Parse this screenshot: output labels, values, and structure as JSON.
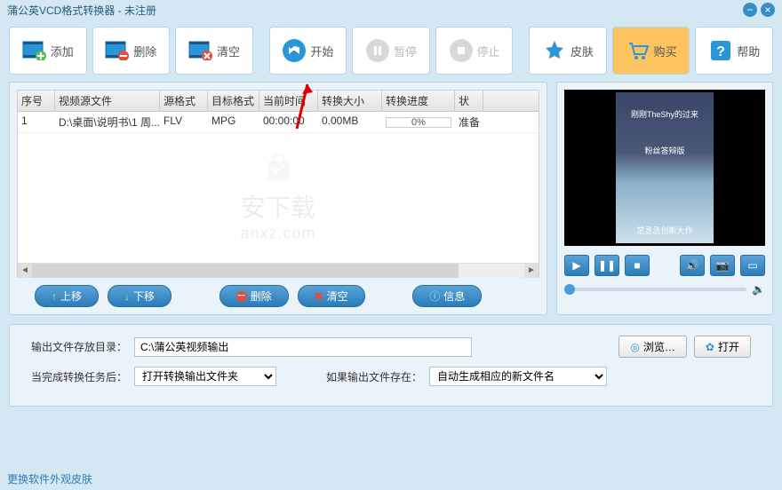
{
  "title": "蒲公英VCD格式转换器 - 未注册",
  "toolbar": {
    "add": "添加",
    "delete": "删除",
    "clear": "清空",
    "start": "开始",
    "pause": "暂停",
    "stop": "停止",
    "skin": "皮肤",
    "buy": "购买",
    "help": "帮助"
  },
  "table": {
    "headers": {
      "seq": "序号",
      "src": "视频源文件",
      "sf": "源格式",
      "tf": "目标格式",
      "ct": "当前时间",
      "sz": "转换大小",
      "pg": "转换进度",
      "st": "状"
    },
    "rows": [
      {
        "seq": "1",
        "src": "D:\\桌面\\说明书\\1 周...",
        "sf": "FLV",
        "tf": "MPG",
        "ct": "00:00:00",
        "sz": "0.00MB",
        "pg": "0%",
        "st": "准备"
      }
    ]
  },
  "watermark": {
    "line1": "安下载",
    "line2": "anxz.com"
  },
  "actions": {
    "up": "上移",
    "down": "下移",
    "delete": "删除",
    "clear": "清空",
    "info": "信息"
  },
  "preview": {
    "top_text": "刚刚TheShy的过来",
    "mid_text": "粉丝答辩版",
    "bottom_text": "范丞丞创新大作"
  },
  "output": {
    "dir_label": "输出文件存放目录：",
    "dir_value": "C:\\蒲公英视频输出",
    "browse": "浏览…",
    "open": "打开",
    "after_label": "当完成转换任务后：",
    "after_value": "打开转换输出文件夹",
    "exist_label": "如果输出文件存在：",
    "exist_value": "自动生成相应的新文件名"
  },
  "footer_link": "更换软件外观皮肤"
}
